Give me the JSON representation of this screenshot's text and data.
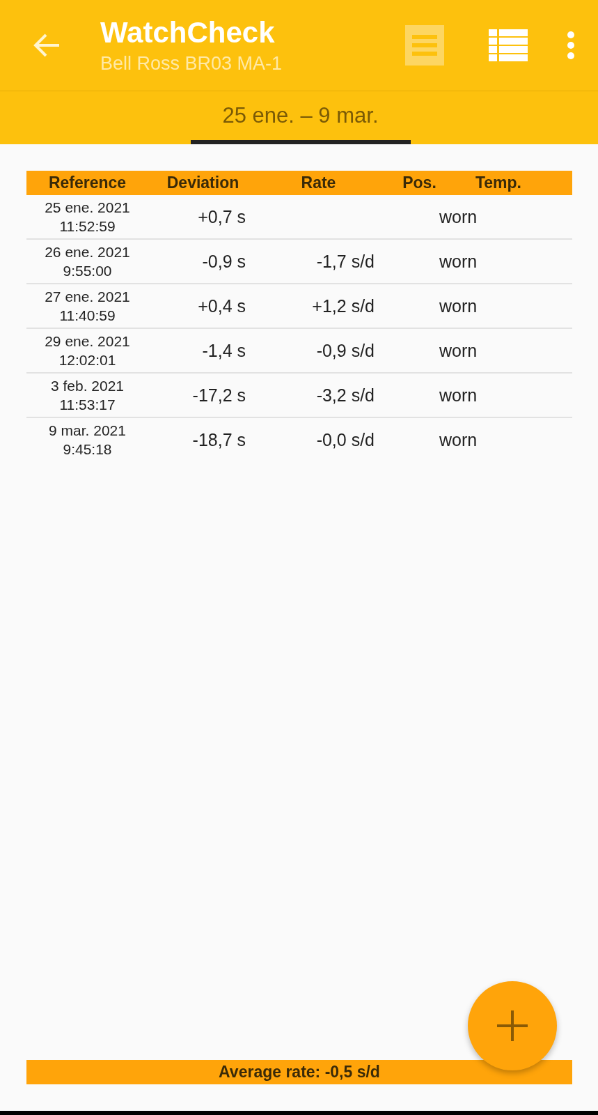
{
  "app_bar": {
    "title": "WatchCheck",
    "subtitle": "Bell Ross BR03 MA-1",
    "actions": [
      {
        "kind": "receipt",
        "disabled": true
      },
      {
        "kind": "list",
        "disabled": false
      }
    ]
  },
  "tabs": [
    {
      "label": "25 ene. – 9 mar.",
      "selected": true
    }
  ],
  "table": {
    "columns": [
      "Reference",
      "Deviation",
      "Rate",
      "Pos.",
      "Temp."
    ],
    "rows": [
      {
        "date": "25 ene. 2021",
        "time": "11:52:59",
        "deviation": "+0,7 s",
        "wear": "worn"
      },
      {
        "date": "26 ene. 2021",
        "time": "9:55:00",
        "deviation": "-0,9 s",
        "rate": "-1,7 s/d",
        "wear": "worn"
      },
      {
        "date": "27 ene. 2021",
        "time": "11:40:59",
        "deviation": "+0,4 s",
        "rate": "+1,2 s/d",
        "wear": "worn"
      },
      {
        "date": "29 ene. 2021",
        "time": "12:02:01",
        "deviation": "-1,4 s",
        "rate": "-0,9 s/d",
        "wear": "worn"
      },
      {
        "date": "3 feb. 2021",
        "time": "11:53:17",
        "deviation": "-17,2 s",
        "rate": "-3,2 s/d",
        "wear": "worn"
      },
      {
        "date": "9 mar. 2021",
        "time": "9:45:18",
        "deviation": "-18,7 s",
        "rate": "-0,0 s/d",
        "wear": "worn"
      }
    ]
  },
  "footer": {
    "text": "Average rate: -0,5 s/d"
  }
}
